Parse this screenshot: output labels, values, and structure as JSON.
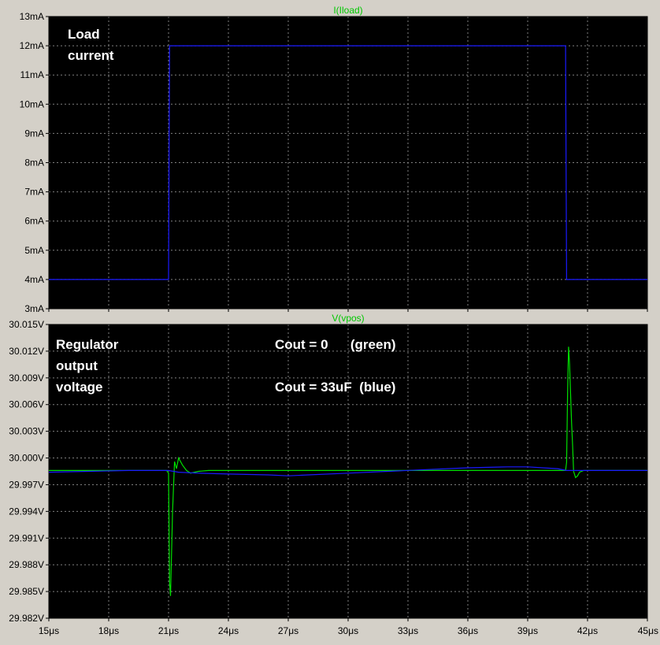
{
  "colors": {
    "frame": "#d4d0c8",
    "plot_bg": "#000000",
    "grid": "#808080",
    "title": "#00c800",
    "green_trace": "#00e000",
    "blue_trace": "#1a1aff",
    "annotation": "#ffffff"
  },
  "chart_data": [
    {
      "type": "line",
      "title": "I(Iload)",
      "xunit": "μs",
      "xlim": [
        15,
        45
      ],
      "xticks": [
        15,
        18,
        21,
        24,
        27,
        30,
        33,
        36,
        39,
        42,
        45
      ],
      "x_tick_labels": [
        "15μs",
        "18μs",
        "21μs",
        "24μs",
        "27μs",
        "30μs",
        "33μs",
        "36μs",
        "39μs",
        "42μs",
        "45μs"
      ],
      "ylim": [
        3,
        13
      ],
      "yticks": [
        3,
        4,
        5,
        6,
        7,
        8,
        9,
        10,
        11,
        12,
        13
      ],
      "y_tick_labels": [
        "3mA",
        "4mA",
        "5mA",
        "6mA",
        "7mA",
        "8mA",
        "9mA",
        "10mA",
        "11mA",
        "12mA",
        "13mA"
      ],
      "grid": true,
      "annotations": [
        {
          "text": "Load",
          "pos": "top-left"
        },
        {
          "text": "current",
          "pos": "top-left"
        }
      ],
      "series": [
        {
          "color": "#1a1aff",
          "x": [
            15,
            21.0,
            21.05,
            40.9,
            40.95,
            45
          ],
          "y": [
            4,
            4,
            12,
            12,
            4,
            4
          ]
        }
      ]
    },
    {
      "type": "line",
      "title": "V(vpos)",
      "xunit": "μs",
      "xlim": [
        15,
        45
      ],
      "xticks": [
        15,
        18,
        21,
        24,
        27,
        30,
        33,
        36,
        39,
        42,
        45
      ],
      "x_tick_labels": [
        "15μs",
        "18μs",
        "21μs",
        "24μs",
        "27μs",
        "30μs",
        "33μs",
        "36μs",
        "39μs",
        "42μs",
        "45μs"
      ],
      "ylim": [
        29.982,
        30.015
      ],
      "yticks": [
        29.982,
        29.985,
        29.988,
        29.991,
        29.994,
        29.997,
        30.0,
        30.003,
        30.006,
        30.009,
        30.012,
        30.015
      ],
      "y_tick_labels": [
        "29.982V",
        "29.985V",
        "29.988V",
        "29.991V",
        "29.994V",
        "29.997V",
        "30.000V",
        "30.003V",
        "30.006V",
        "30.009V",
        "30.012V",
        "30.015V"
      ],
      "grid": true,
      "annotations": [
        {
          "text": "Regulator",
          "pos": "top-left"
        },
        {
          "text": "output",
          "pos": "top-left"
        },
        {
          "text": "voltage",
          "pos": "top-left"
        },
        {
          "text": "Cout = 0      (green)",
          "pos": "top-center"
        },
        {
          "text": "Cout = 33uF  (blue)",
          "pos": "top-center"
        }
      ],
      "series": [
        {
          "color": "#00e000",
          "x": [
            15,
            20.9,
            21.0,
            21.05,
            21.1,
            21.2,
            21.3,
            21.4,
            21.5,
            21.7,
            21.9,
            22.1,
            22.5,
            23,
            30,
            40.9,
            40.95,
            41.0,
            41.05,
            41.1,
            41.2,
            41.25,
            41.3,
            41.4,
            41.5,
            41.6,
            41.8,
            42.0,
            42.4,
            45
          ],
          "y": [
            29.9986,
            29.9986,
            29.9983,
            29.986,
            29.9845,
            29.994,
            29.9996,
            29.9988,
            30.0,
            29.9992,
            29.9986,
            29.9983,
            29.9985,
            29.9986,
            29.9986,
            29.9986,
            29.9995,
            30.0075,
            30.0125,
            30.0105,
            30.004,
            30.0015,
            29.9985,
            29.9978,
            29.998,
            29.9984,
            29.9986,
            29.9986,
            29.9986,
            29.9986
          ]
        },
        {
          "color": "#1a1aff",
          "x": [
            15,
            17,
            19,
            20.5,
            21.0,
            21.5,
            22.5,
            24,
            26,
            27,
            28,
            30,
            32,
            34,
            36,
            38,
            39,
            40.5,
            40.95,
            41.5,
            42,
            43,
            45
          ],
          "y": [
            29.9984,
            29.9985,
            29.9986,
            29.9986,
            29.9986,
            29.9984,
            29.9983,
            29.9982,
            29.9981,
            29.998,
            29.9981,
            29.9983,
            29.9985,
            29.9987,
            29.9989,
            29.999,
            29.999,
            29.9988,
            29.9986,
            29.9986,
            29.9986,
            29.9986,
            29.9986
          ]
        }
      ]
    }
  ]
}
